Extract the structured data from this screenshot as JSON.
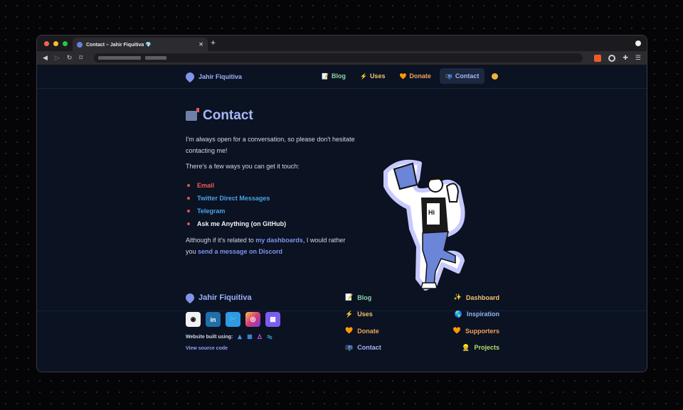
{
  "browser": {
    "tab_title": "Contact – Jahir Fiquitiva 💎",
    "tab_close": "✕",
    "new_tab": "+",
    "nav_back": "◀",
    "nav_forward": "▷",
    "nav_reload": "↻",
    "nav_bookmark": "⌑",
    "menu_icon": "☰",
    "extensions_icon": "✚"
  },
  "nav": {
    "brand": "Jahir Fiquitiva",
    "items": [
      {
        "label": "Blog",
        "emoji": "📝",
        "color": "#8cd6a8"
      },
      {
        "label": "Uses",
        "emoji": "⚡",
        "color": "#f3c46a"
      },
      {
        "label": "Donate",
        "emoji": "🧡",
        "color": "#f0a25a"
      },
      {
        "label": "Contact",
        "emoji": "📭",
        "color": "#a7b8f7"
      }
    ]
  },
  "main": {
    "title": "Contact",
    "intro": "I'm always open for a conversation, so please don't hesitate contacting me!",
    "ways": "There's a few ways you can get it touch:",
    "links": [
      {
        "label": "Email",
        "color": "#f05a5a"
      },
      {
        "label": "Twitter Direct Messages",
        "color": "#4aa3e6"
      },
      {
        "label": "Telegram",
        "color": "#4aa3e6"
      },
      {
        "label": "Ask me Anything (on GitHub)",
        "color": "#f2f2f5"
      }
    ],
    "outro_start": "Although if it's related to ",
    "outro_link1": "my dashboards",
    "outro_mid": ", I would rather you ",
    "outro_link2": "send a message on Discord",
    "illustration_label": "Hi"
  },
  "footer": {
    "brand": "Jahir Fiquitiva",
    "built_with": "Website built using:",
    "source": "View source code",
    "socials": [
      {
        "name": "github",
        "glyph": "◉",
        "bg": "#f2f2f2",
        "fg": "#111"
      },
      {
        "name": "linkedin",
        "glyph": "in",
        "bg": "#1f6fa8",
        "fg": "#fff"
      },
      {
        "name": "twitter",
        "glyph": "🐦",
        "bg": "#2f9ae6",
        "fg": "#fff"
      },
      {
        "name": "instagram",
        "glyph": "◎",
        "bg": "#d63b7a",
        "fg": "#fff"
      },
      {
        "name": "polywork",
        "glyph": "▦",
        "bg": "#7b5cf0",
        "fg": "#fff"
      }
    ],
    "col1": [
      {
        "label": "Blog",
        "emoji": "📝",
        "color": "#8cd6a8"
      },
      {
        "label": "Uses",
        "emoji": "⚡",
        "color": "#f3c46a"
      },
      {
        "label": "Donate",
        "emoji": "🧡",
        "color": "#f0a25a"
      },
      {
        "label": "Contact",
        "emoji": "📭",
        "color": "#a7b8f7"
      }
    ],
    "col2": [
      {
        "label": "Dashboard",
        "emoji": "✨",
        "color": "#f3c46a"
      },
      {
        "label": "Inspiration",
        "emoji": "🌎",
        "color": "#8cb8f0"
      },
      {
        "label": "Supporters",
        "emoji": "🧡",
        "color": "#f0a25a"
      },
      {
        "label": "Projects",
        "emoji": "👷",
        "color": "#b7df6a"
      }
    ]
  }
}
